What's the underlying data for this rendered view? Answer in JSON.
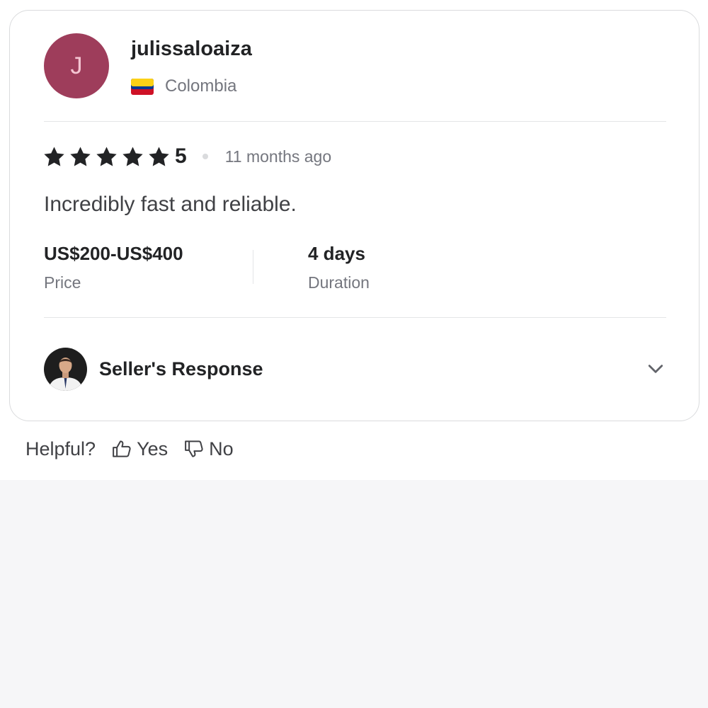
{
  "review": {
    "avatar_letter": "J",
    "username": "julissaloaiza",
    "country": "Colombia",
    "flag_icon": "colombia-flag-icon",
    "rating": "5",
    "time_ago": "11 months ago",
    "text": "Incredibly fast and reliable.",
    "price_value": "US$200-US$400",
    "price_label": "Price",
    "duration_value": "4 days",
    "duration_label": "Duration",
    "seller_response_label": "Seller's Response"
  },
  "helpful": {
    "label": "Helpful?",
    "yes": "Yes",
    "no": "No"
  },
  "colors": {
    "avatar_bg": "#9e3d5b",
    "star": "#222325",
    "page_bg": "#f6f6f8"
  }
}
